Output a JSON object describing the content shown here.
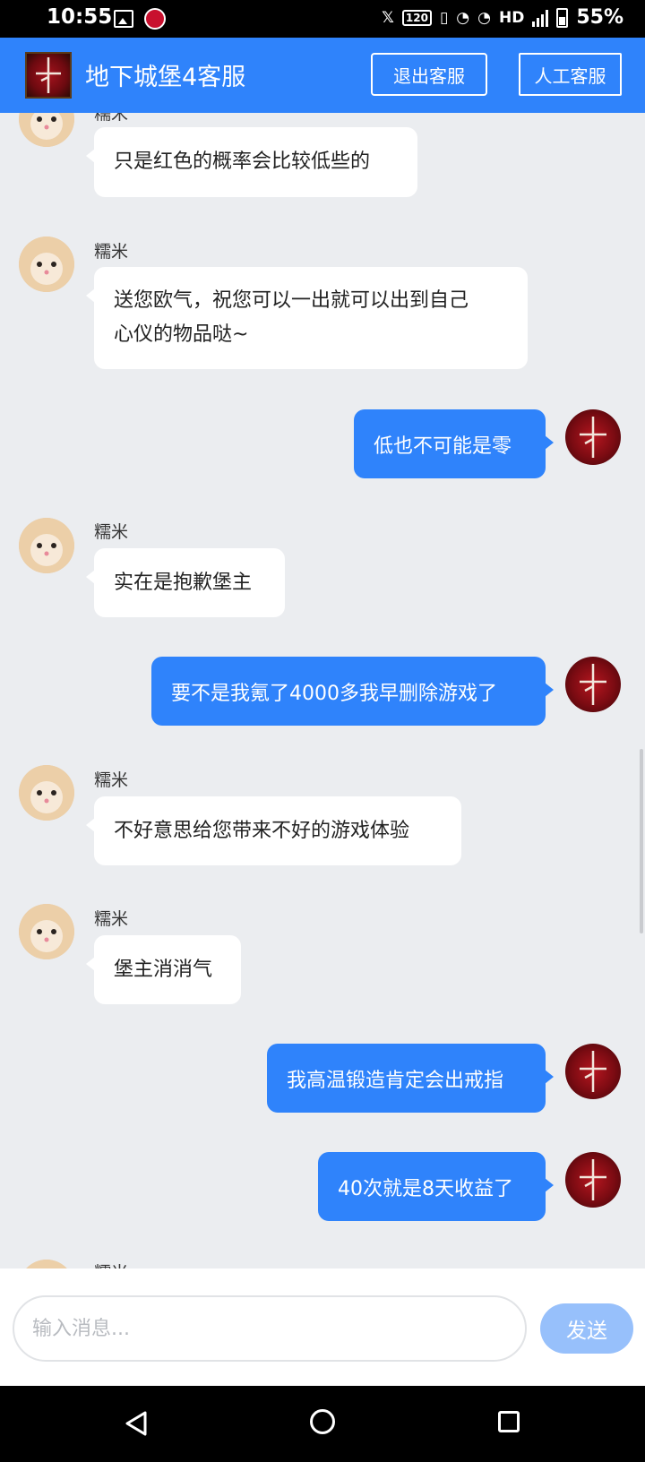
{
  "status_bar": {
    "time": "10:55",
    "network": "HD",
    "battery": "55%"
  },
  "header": {
    "title": "地下城堡4客服",
    "exit_button": "退出客服",
    "human_button": "人工客服"
  },
  "chat": {
    "agent_name": "糯米",
    "messages": [
      {
        "from": "agent",
        "text": "只是红色的概率会比较低些的"
      },
      {
        "from": "agent",
        "lines": [
          "送您欧气，祝您可以一出就可以出到自己",
          "心仪的物品哒~"
        ]
      },
      {
        "from": "user",
        "text": "低也不可能是零"
      },
      {
        "from": "agent",
        "text": "实在是抱歉堡主"
      },
      {
        "from": "user",
        "text": "要不是我氪了4000多我早删除游戏了"
      },
      {
        "from": "agent",
        "text": "不好意思给您带来不好的游戏体验"
      },
      {
        "from": "agent",
        "text": "堡主消消气"
      },
      {
        "from": "user",
        "text": "我高温锻造肯定会出戒指"
      },
      {
        "from": "user",
        "text": "40次就是8天收益了"
      }
    ]
  },
  "input": {
    "placeholder": "输入消息...",
    "send_label": "发送"
  },
  "colors": {
    "brand_blue": "#2f83fb",
    "send_disabled": "#97c0fb",
    "chat_bg": "#ebedf0"
  }
}
